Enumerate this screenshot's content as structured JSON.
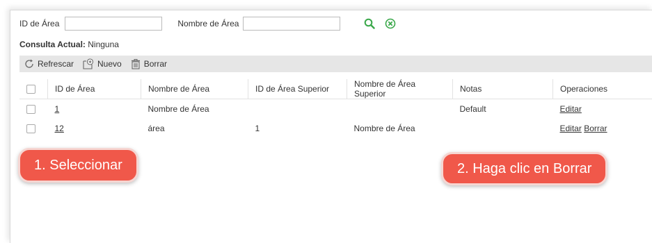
{
  "search": {
    "id_label": "ID de Área",
    "id_value": "",
    "name_label": "Nombre de Área",
    "name_value": ""
  },
  "consulta": {
    "label": "Consulta Actual:",
    "value": "Ninguna"
  },
  "toolbar": {
    "refresh_label": "Refrescar",
    "new_label": "Nuevo",
    "delete_label": "Borrar"
  },
  "table": {
    "headers": [
      "ID de Área",
      "Nombre de Área",
      "ID de Área Superior",
      "Nombre de Área Superior",
      "Notas",
      "Operaciones"
    ],
    "rows": [
      {
        "id": "1",
        "name": "Nombre de Área",
        "parent_id": "",
        "parent_name": "",
        "notes": "Default",
        "edit": "Editar",
        "delete": ""
      },
      {
        "id": "12",
        "name": "área",
        "parent_id": "1",
        "parent_name": "Nombre de Área",
        "notes": "",
        "edit": "Editar",
        "delete": "Borrar"
      }
    ]
  },
  "callouts": {
    "select": "1. Seleccionar",
    "click_delete": "2. Haga clic en Borrar"
  },
  "colors": {
    "accent_green": "#3aa84a",
    "callout_red": "#f0584a",
    "toolbar_bg": "#e6e6e6"
  }
}
